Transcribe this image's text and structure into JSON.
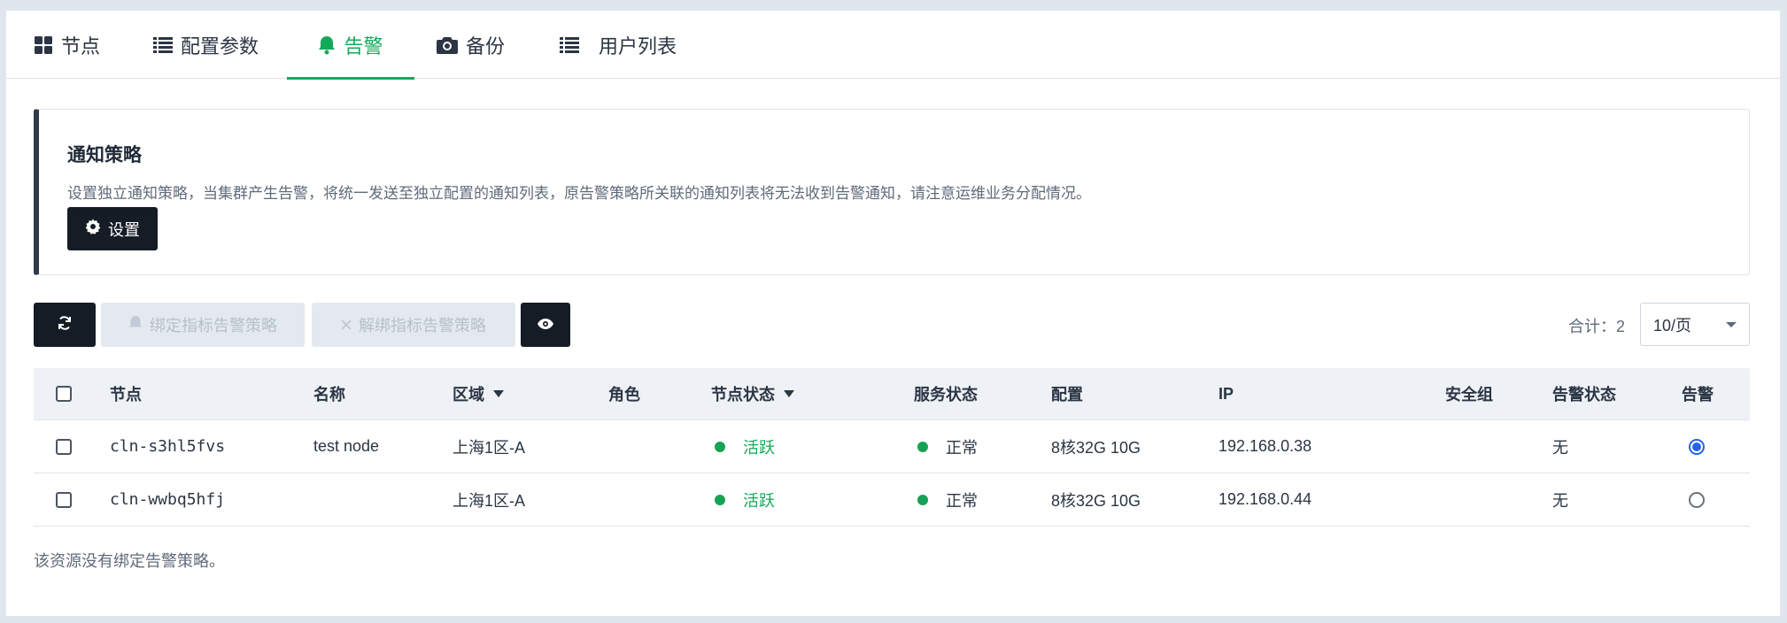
{
  "tabs": [
    {
      "label": "节点",
      "icon": "grid-icon"
    },
    {
      "label": "配置参数",
      "icon": "list-icon"
    },
    {
      "label": "告警",
      "icon": "bell-icon",
      "active": true
    },
    {
      "label": "备份",
      "icon": "camera-icon"
    },
    {
      "label": "用户列表",
      "icon": "list-icon"
    }
  ],
  "notice": {
    "title": "通知策略",
    "description": "设置独立通知策略，当集群产生告警，将统一发送至独立配置的通知列表，原告警策略所关联的通知列表将无法收到告警通知，请注意运维业务分配情况。",
    "settings_button": "设置"
  },
  "toolbar": {
    "bind_button": "绑定指标告警策略",
    "unbind_button": "解绑指标告警策略",
    "total_label": "合计：2",
    "page_size": "10/页"
  },
  "table": {
    "headers": {
      "node": "节点",
      "name": "名称",
      "zone": "区域",
      "role": "角色",
      "node_status": "节点状态",
      "service_status": "服务状态",
      "config": "配置",
      "ip": "IP",
      "security_group": "安全组",
      "alert_status": "告警状态",
      "alert": "告警"
    },
    "rows": [
      {
        "node": "cln-s3hl5fvs",
        "name": "test node",
        "zone": "上海1区-A",
        "role": "",
        "node_status": "活跃",
        "service_status": "正常",
        "config": "8核32G 10G",
        "ip": "192.168.0.38",
        "security_group": "",
        "alert_status": "无",
        "alert_selected": true
      },
      {
        "node": "cln-wwbq5hfj",
        "name": "",
        "zone": "上海1区-A",
        "role": "",
        "node_status": "活跃",
        "service_status": "正常",
        "config": "8核32G 10G",
        "ip": "192.168.0.44",
        "security_group": "",
        "alert_status": "无",
        "alert_selected": false
      }
    ]
  },
  "footer_note": "该资源没有绑定告警策略。",
  "colors": {
    "accent": "#16a85a",
    "dark_button": "#151c26",
    "radio_on": "#2563eb"
  }
}
